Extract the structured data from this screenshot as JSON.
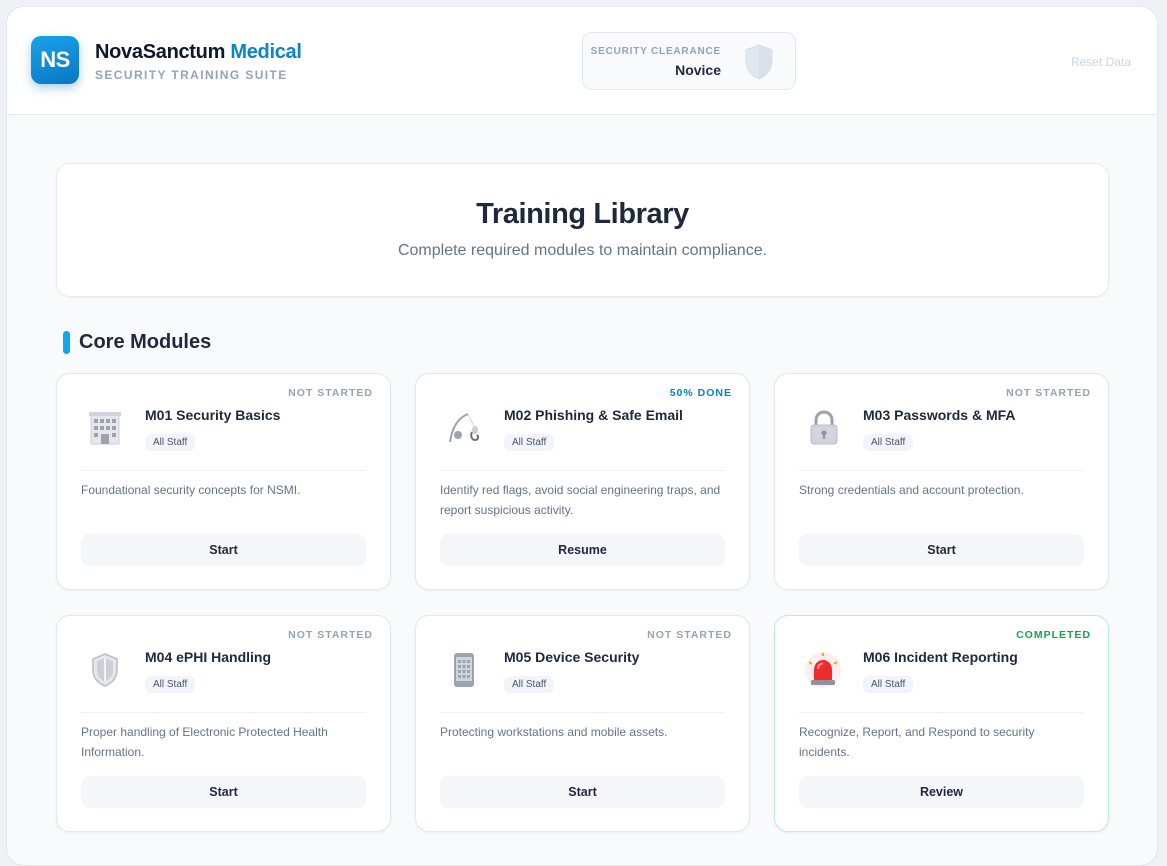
{
  "brand": {
    "logo_initials": "NS",
    "name_main": "NovaSanctum",
    "name_accent": "Medical",
    "subtitle": "SECURITY TRAINING SUITE"
  },
  "clearance": {
    "label": "SECURITY CLEARANCE",
    "value": "Novice",
    "icon": "shield-icon"
  },
  "header": {
    "reset_label": "Reset Data"
  },
  "hero": {
    "title": "Training Library",
    "subtitle": "Complete required modules to maintain compliance."
  },
  "section": {
    "title": "Core Modules"
  },
  "colors": {
    "accent": "#0a84cf",
    "section_bar": "#0ea5e9",
    "status_progress": "#0284c7",
    "status_completed": "#16a34a",
    "status_default": "#94a3b8"
  },
  "modules": [
    {
      "id": "m01",
      "status": "NOT STARTED",
      "state": "default",
      "icon": "office-building-icon",
      "title": "M01 Security Basics",
      "tag": "All Staff",
      "description": "Foundational security concepts for NSMI.",
      "button": "Start"
    },
    {
      "id": "m02",
      "status": "50% DONE",
      "state": "progress",
      "icon": "fishing-hook-icon",
      "title": "M02 Phishing & Safe Email",
      "tag": "All Staff",
      "description": "Identify red flags, avoid social engineering traps, and report suspicious activity.",
      "button": "Resume"
    },
    {
      "id": "m03",
      "status": "NOT STARTED",
      "state": "default",
      "icon": "lock-icon",
      "title": "M03 Passwords & MFA",
      "tag": "All Staff",
      "description": "Strong credentials and account protection.",
      "button": "Start"
    },
    {
      "id": "m04",
      "status": "NOT STARTED",
      "state": "default",
      "icon": "shield-icon",
      "title": "M04 ePHI Handling",
      "tag": "All Staff",
      "description": "Proper handling of Electronic Protected Health Information.",
      "button": "Start"
    },
    {
      "id": "m05",
      "status": "NOT STARTED",
      "state": "default",
      "icon": "mobile-phone-icon",
      "title": "M05 Device Security",
      "tag": "All Staff",
      "description": "Protecting workstations and mobile assets.",
      "button": "Start"
    },
    {
      "id": "m06",
      "status": "COMPLETED",
      "state": "done",
      "icon": "siren-icon",
      "title": "M06 Incident Reporting",
      "tag": "All Staff",
      "description": "Recognize, Report, and Respond to security incidents.",
      "button": "Review"
    }
  ]
}
